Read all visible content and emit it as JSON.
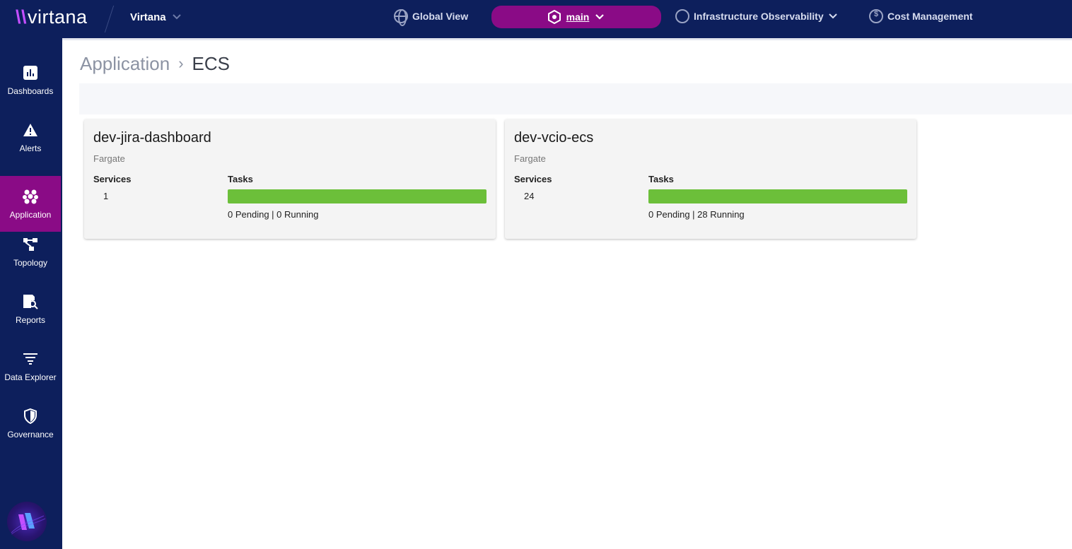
{
  "header": {
    "brand": "virtana",
    "tenant": "Virtana",
    "nav": {
      "global_view": "Global View",
      "environment": "main",
      "infra": "Infrastructure Observability",
      "cost": "Cost Management"
    }
  },
  "sidebar": {
    "items": [
      {
        "label": "Dashboards",
        "icon": "bar-chart-icon"
      },
      {
        "label": "Alerts",
        "icon": "warning-icon"
      },
      {
        "label": "Application",
        "icon": "hexagons-icon"
      },
      {
        "label": "Topology",
        "icon": "topology-icon"
      },
      {
        "label": "Reports",
        "icon": "report-search-icon"
      },
      {
        "label": "Data Explorer",
        "icon": "filter-lines-icon"
      },
      {
        "label": "Governance",
        "icon": "shield-icon"
      }
    ],
    "active": "Application"
  },
  "breadcrumb": {
    "parent": "Application",
    "separator": "›",
    "current": "ECS"
  },
  "clusters": [
    {
      "name": "dev-jira-dashboard",
      "launch_type": "Fargate",
      "services_label": "Services",
      "services": "1",
      "tasks_label": "Tasks",
      "tasks_summary": "0 Pending | 0 Running",
      "running_fraction": 1.0
    },
    {
      "name": "dev-vcio-ecs",
      "launch_type": "Fargate",
      "services_label": "Services",
      "services": "24",
      "tasks_label": "Tasks",
      "tasks_summary": "0 Pending | 28 Running",
      "running_fraction": 1.0
    }
  ],
  "colors": {
    "nav_bg": "#0d1f5c",
    "accent": "#8a0b86",
    "bar_running": "#6cbf3a"
  }
}
